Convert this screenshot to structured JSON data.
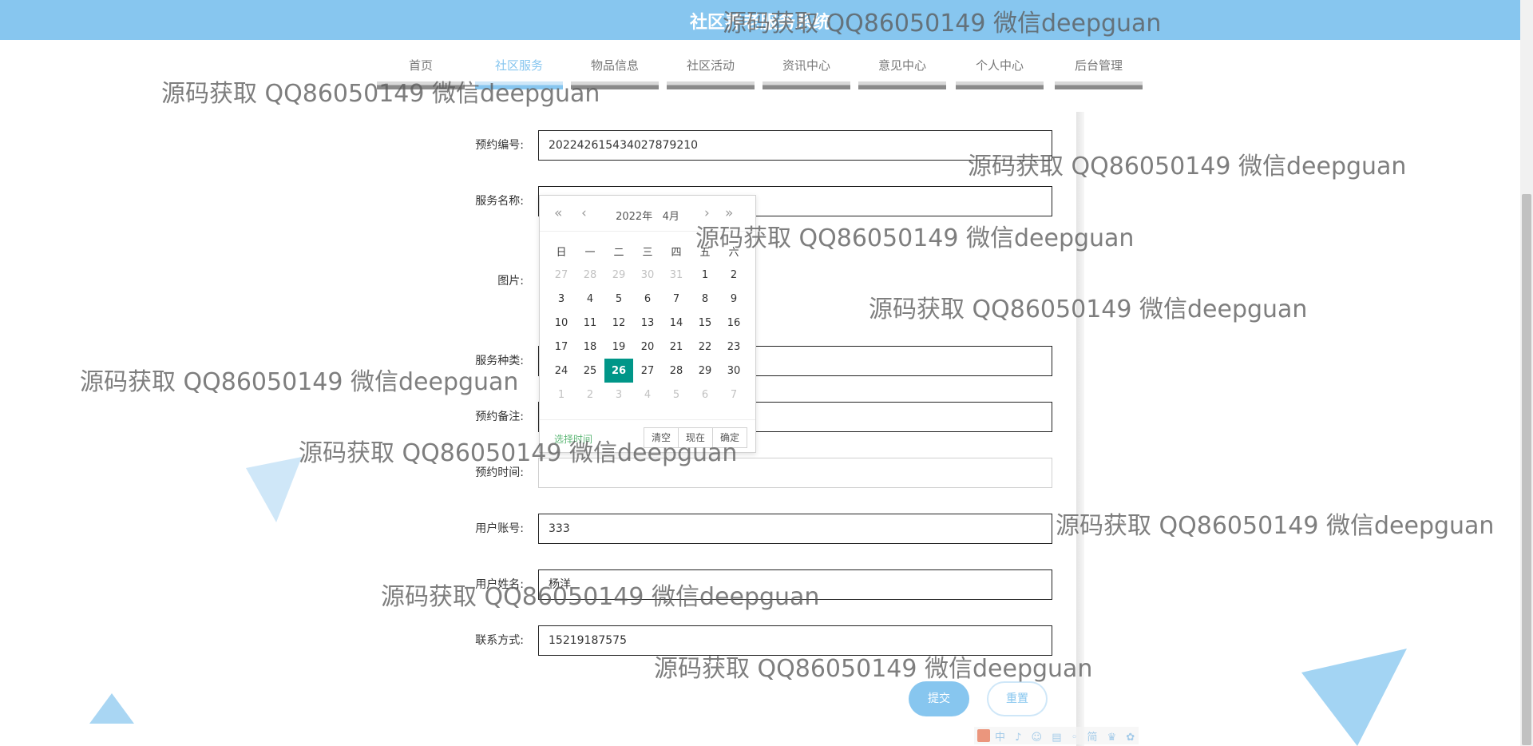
{
  "header": {
    "title": "社区养老服务系统"
  },
  "nav": {
    "items": [
      {
        "label": "首页"
      },
      {
        "label": "社区服务"
      },
      {
        "label": "物品信息"
      },
      {
        "label": "社区活动"
      },
      {
        "label": "资讯中心"
      },
      {
        "label": "意见中心"
      },
      {
        "label": "个人中心"
      },
      {
        "label": "后台管理"
      }
    ],
    "active": "社区服务"
  },
  "form": {
    "booking_no": {
      "label": "预约编号:",
      "value": "202242615434027879210"
    },
    "service_name": {
      "label": "服务名称:",
      "value": ""
    },
    "image": {
      "label": "图片:"
    },
    "service_type": {
      "label": "服务种类:",
      "value": ""
    },
    "booking_note": {
      "label": "预约备注:",
      "value": ""
    },
    "booking_time": {
      "label": "预约时间:",
      "value": ""
    },
    "user_account": {
      "label": "用户账号:",
      "value": "333"
    },
    "user_name": {
      "label": "用户姓名:",
      "value": "杨洋"
    },
    "contact": {
      "label": "联系方式:",
      "value": "15219187575"
    }
  },
  "datepicker": {
    "year_label": "2022年",
    "month_label": "4月",
    "weekdays": [
      "日",
      "一",
      "二",
      "三",
      "四",
      "五",
      "六"
    ],
    "weeks": [
      [
        "27",
        "28",
        "29",
        "30",
        "31",
        "1",
        "2"
      ],
      [
        "3",
        "4",
        "5",
        "6",
        "7",
        "8",
        "9"
      ],
      [
        "10",
        "11",
        "12",
        "13",
        "14",
        "15",
        "16"
      ],
      [
        "17",
        "18",
        "19",
        "20",
        "21",
        "22",
        "23"
      ],
      [
        "24",
        "25",
        "26",
        "27",
        "28",
        "29",
        "30"
      ],
      [
        "1",
        "2",
        "3",
        "4",
        "5",
        "6",
        "7"
      ]
    ],
    "selected_day": "26",
    "select_time_label": "选择时间",
    "clear_label": "清空",
    "now_label": "现在",
    "confirm_label": "确定"
  },
  "buttons": {
    "submit": "提交",
    "reset": "重置"
  },
  "ime": {
    "text": "中 ♪ ☺ ▤ ◦ 简 ♛ ✿"
  },
  "watermark": "源码获取 QQ86050149 微信deepguan",
  "colors": {
    "primary": "#87c6ef",
    "selected": "#009688",
    "pick_time": "#5fb878"
  }
}
